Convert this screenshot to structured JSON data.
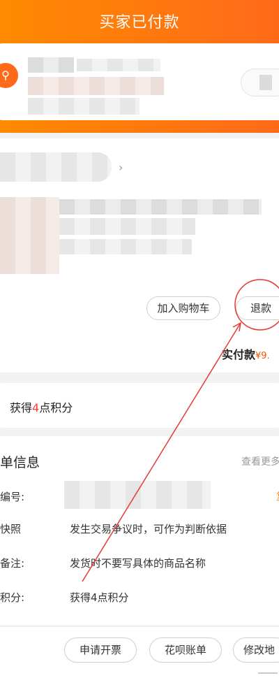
{
  "header": {
    "title": "买家已付款"
  },
  "address": {
    "location_icon": "location-pin-icon"
  },
  "goods": {
    "actions": {
      "add_to_cart": "加入购物车",
      "refund": "退款"
    }
  },
  "order_total": {
    "label": "实付款",
    "amount": "¥9."
  },
  "points": {
    "prefix": "获得",
    "count": "4",
    "suffix": "点积分"
  },
  "order_info": {
    "title": "单信息",
    "view_more": "查看更多",
    "rows": [
      {
        "label": "编号:",
        "value": ""
      },
      {
        "label": "快照",
        "value": "发生交易争议时，可作为判断依据"
      },
      {
        "label": "备注:",
        "value": "发货时不要写具体的商品名称"
      },
      {
        "label": "积分:",
        "value": "获得4点积分"
      }
    ]
  },
  "bottom_bar": {
    "buttons": [
      "申请开票",
      "花呗账单",
      "修改地"
    ]
  },
  "colors": {
    "accent": "#ff6a1a",
    "price": "#ff5000",
    "annotation": "#e53935"
  }
}
